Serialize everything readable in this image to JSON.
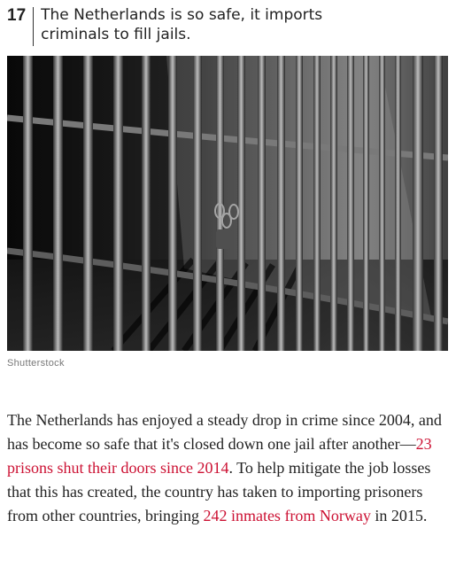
{
  "item": {
    "number": "17",
    "title": "The Netherlands is so safe, it imports criminals to fill jails."
  },
  "image": {
    "icon": "jail-bars-photo",
    "credit": "Shutterstock"
  },
  "article": {
    "p1": "The Netherlands has enjoyed a steady drop in crime since 2004, and has become so safe that it's closed down one jail after another—",
    "link1": "23 prisons shut their doors since 2014",
    "p2": ". To help mitigate the job losses that this has created, the country has taken to importing prisoners from other countries, bringing ",
    "link2": "242 inmates from Norway",
    "p3": " in 2015."
  },
  "colors": {
    "link": "#cc1133",
    "text": "#222222"
  }
}
